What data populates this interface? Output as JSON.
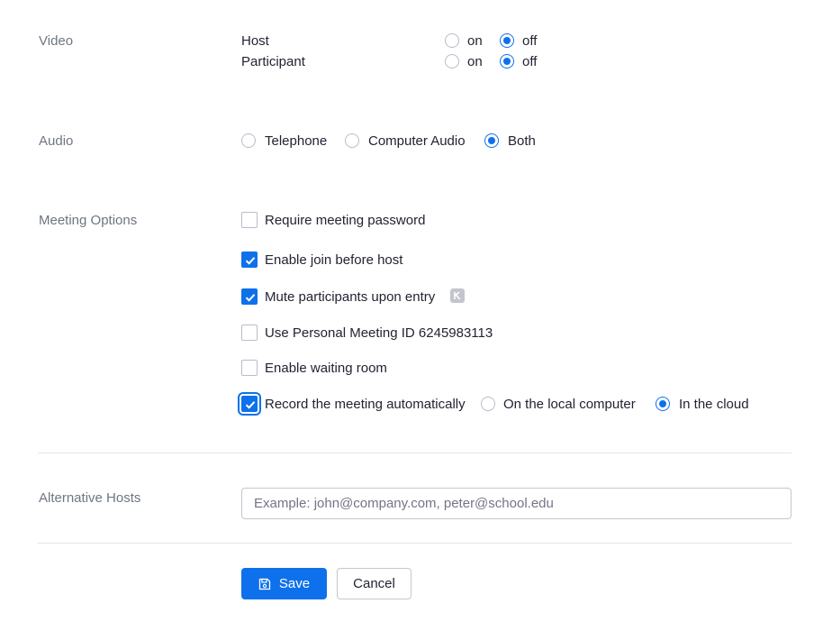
{
  "video": {
    "label": "Video",
    "host": {
      "label": "Host",
      "on": "on",
      "off": "off",
      "selected": "off"
    },
    "participant": {
      "label": "Participant",
      "on": "on",
      "off": "off",
      "selected": "off"
    }
  },
  "audio": {
    "label": "Audio",
    "options": [
      "Telephone",
      "Computer Audio",
      "Both"
    ],
    "selected": "Both"
  },
  "meeting_options": {
    "label": "Meeting Options",
    "require_password": {
      "label": "Require meeting password",
      "checked": false
    },
    "join_before_host": {
      "label": "Enable join before host",
      "checked": true
    },
    "mute_on_entry": {
      "label": "Mute participants upon entry",
      "checked": true
    },
    "personal_meeting_id": {
      "label": "Use Personal Meeting ID 6245983113",
      "checked": false
    },
    "waiting_room": {
      "label": "Enable waiting room",
      "checked": false
    },
    "record_auto": {
      "label": "Record the meeting automatically",
      "checked": true,
      "local": "On the local computer",
      "cloud": "In the cloud",
      "selected": "cloud"
    }
  },
  "alternative_hosts": {
    "label": "Alternative Hosts",
    "value": "",
    "placeholder": "Example: john@company.com, peter@school.edu"
  },
  "actions": {
    "save": "Save",
    "cancel": "Cancel"
  },
  "colors": {
    "accent": "#0e71eb",
    "label": "#6e7680",
    "text": "#232333"
  }
}
